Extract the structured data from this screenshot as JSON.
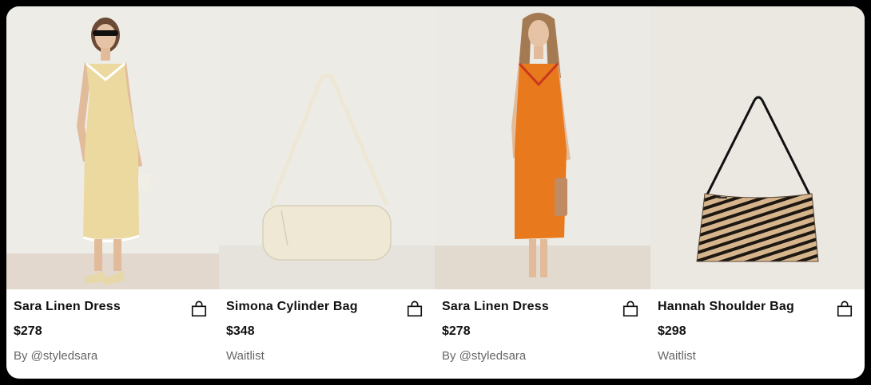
{
  "products": [
    {
      "name": "Sara Linen Dress",
      "price": "$278",
      "sub": "By @styledsara",
      "image": "woman-in-yellow-linen-dress",
      "icon": "shopping-bag-icon"
    },
    {
      "name": "Simona Cylinder Bag",
      "price": "$348",
      "sub": "Waitlist",
      "image": "cream-cylinder-shoulder-bag",
      "icon": "shopping-bag-icon"
    },
    {
      "name": "Sara Linen Dress",
      "price": "$278",
      "sub": "By @styledsara",
      "image": "woman-in-orange-linen-dress",
      "icon": "shopping-bag-icon"
    },
    {
      "name": "Hannah Shoulder Bag",
      "price": "$298",
      "sub": "Waitlist",
      "image": "zebra-print-shoulder-bag",
      "icon": "shopping-bag-icon"
    }
  ]
}
